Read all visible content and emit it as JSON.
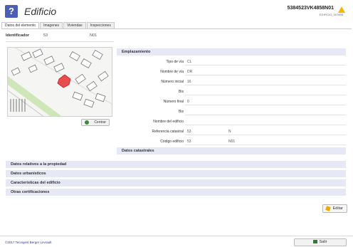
{
  "header": {
    "icon_glyph": "?",
    "title": "Edificio",
    "reference": "5384523VK4858N01",
    "sub_reference": "EDIFICIO_007658"
  },
  "tabs": [
    {
      "label": "Datos del elemento",
      "active": true
    },
    {
      "label": "Imagenes",
      "active": false
    },
    {
      "label": "Viviendas",
      "active": false
    },
    {
      "label": "Inspecciones",
      "active": false
    }
  ],
  "identificador": {
    "label": "Identificador",
    "value1": "53",
    "value2": "N01"
  },
  "map": {
    "center_button": "Centrar"
  },
  "emplazamiento": {
    "title": "Emplazamiento",
    "fields": [
      {
        "label": "Tipo de vía",
        "value": "CL"
      },
      {
        "label": "Nombre de vía",
        "value": "DR"
      },
      {
        "label": "Número inicial",
        "value": "16"
      },
      {
        "label": "Bis",
        "value": ""
      },
      {
        "label": "Número final",
        "value": "0"
      },
      {
        "label": "Bis",
        "value": ""
      },
      {
        "label": "Nombre del edificio",
        "value": ""
      },
      {
        "label": "Referencia catastral",
        "value": "53",
        "value2": "N"
      },
      {
        "label": "Código edificio",
        "value": "53",
        "value2": "N01"
      }
    ]
  },
  "datos_catastrales": {
    "title": "Datos catastrales"
  },
  "sections": [
    {
      "title": "Datos relativos a la propiedad"
    },
    {
      "title": "Datos urbanísticos"
    },
    {
      "title": "Características del edificio"
    },
    {
      "title": "Otras certificaciones"
    }
  ],
  "edit_button": "Editar",
  "footer": {
    "copyright": "©2017 Tecnigest Berger Levrault",
    "exit_button": "Salir"
  },
  "colors": {
    "section_bar": "#e7e8f6",
    "accent_blue": "#4b5fb4",
    "highlight_building": "#e84c4c"
  }
}
